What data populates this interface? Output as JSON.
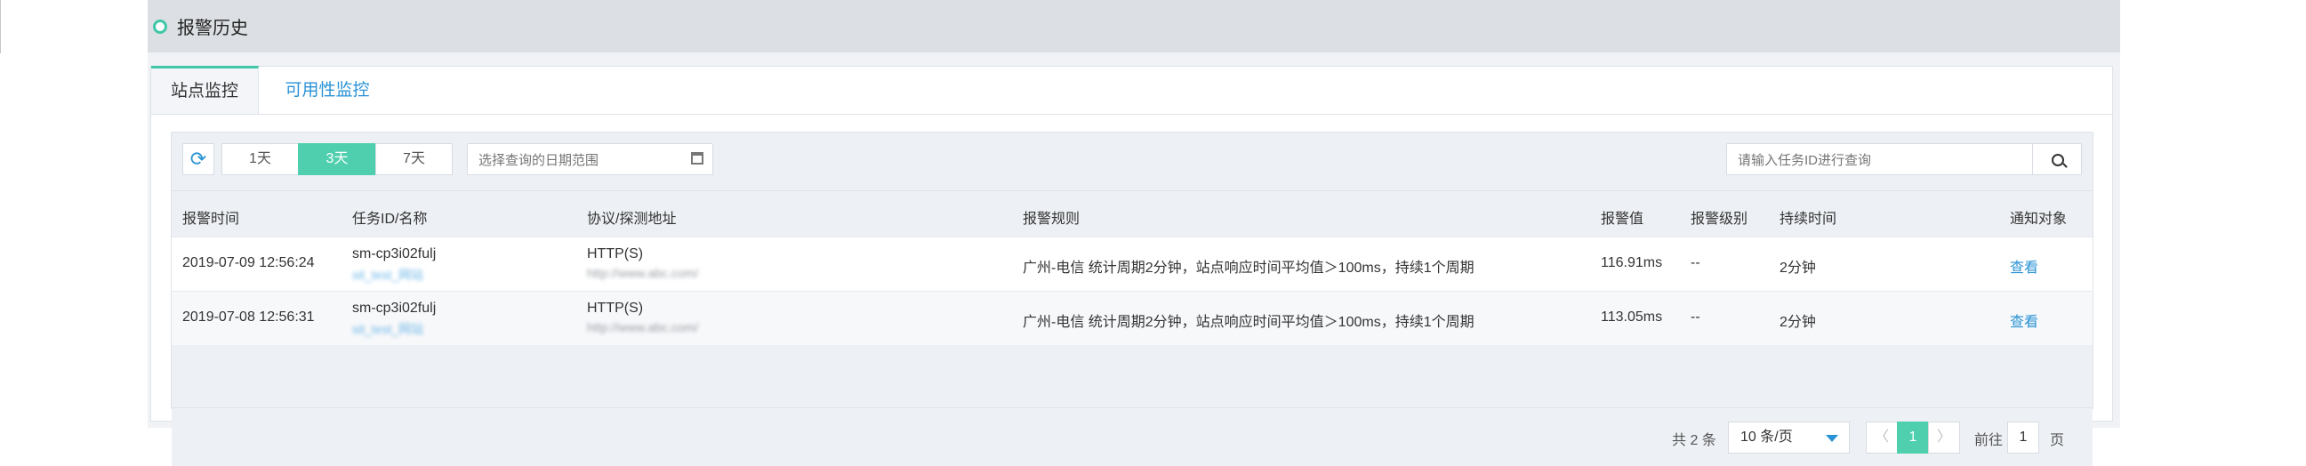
{
  "header": {
    "title": "报警历史"
  },
  "tabs": [
    {
      "label": "站点监控",
      "active": true
    },
    {
      "label": "可用性监控",
      "active": false
    }
  ],
  "toolbar": {
    "ranges": [
      "1天",
      "3天",
      "7天"
    ],
    "selected_range": "3天",
    "date_placeholder": "选择查询的日期范围",
    "search_placeholder": "请输入任务ID进行查询"
  },
  "table": {
    "columns": [
      "报警时间",
      "任务ID/名称",
      "协议/探测地址",
      "报警规则",
      "报警值",
      "报警级别",
      "持续时间",
      "通知对象"
    ],
    "rows": [
      {
        "time": "2019-07-09 12:56:24",
        "task_id": "sm-cp3i02fulj",
        "task_name": "sit_test_网站",
        "protocol": "HTTP(S)",
        "address": "http://www.abc.com/",
        "rule": "广州-电信 统计周期2分钟，站点响应时间平均值＞100ms，持续1个周期",
        "value": "116.91ms",
        "level": "--",
        "duration": "2分钟",
        "notify": "查看"
      },
      {
        "time": "2019-07-08 12:56:31",
        "task_id": "sm-cp3i02fulj",
        "task_name": "sit_test_网站",
        "protocol": "HTTP(S)",
        "address": "http://www.abc.com/",
        "rule": "广州-电信 统计周期2分钟，站点响应时间平均值＞100ms，持续1个周期",
        "value": "113.05ms",
        "level": "--",
        "duration": "2分钟",
        "notify": "查看"
      }
    ]
  },
  "pager": {
    "total": "共 2 条",
    "page_size": "10 条/页",
    "prev": "〈",
    "current": "1",
    "next": "〉",
    "goto_label": "前往",
    "goto_value": "1",
    "suffix": "页"
  },
  "colors": {
    "accent": "#4fcfae",
    "link": "#2a93d5",
    "header_bg": "#dcdfe3"
  },
  "icons": {
    "refresh": "refresh-icon",
    "calendar": "calendar-icon",
    "search": "search-icon",
    "status": "circle-icon"
  }
}
